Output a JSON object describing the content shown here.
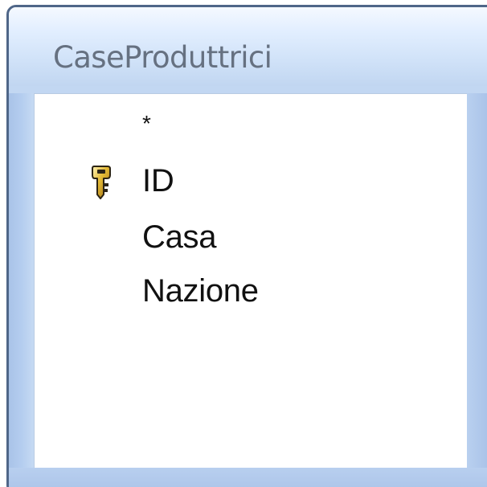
{
  "table": {
    "title": "CaseProduttrici"
  },
  "fields": [
    {
      "label": "*",
      "primary_key": false
    },
    {
      "label": "ID",
      "primary_key": true
    },
    {
      "label": "Casa",
      "primary_key": false
    },
    {
      "label": "Nazione",
      "primary_key": false
    }
  ],
  "icons": {
    "primary_key": "key-icon"
  },
  "colors": {
    "border": "#4f6688",
    "frame": "#c2d7f2",
    "title_text": "#667181",
    "field_background": "#ffffff",
    "key_fill": "#e1b332"
  }
}
